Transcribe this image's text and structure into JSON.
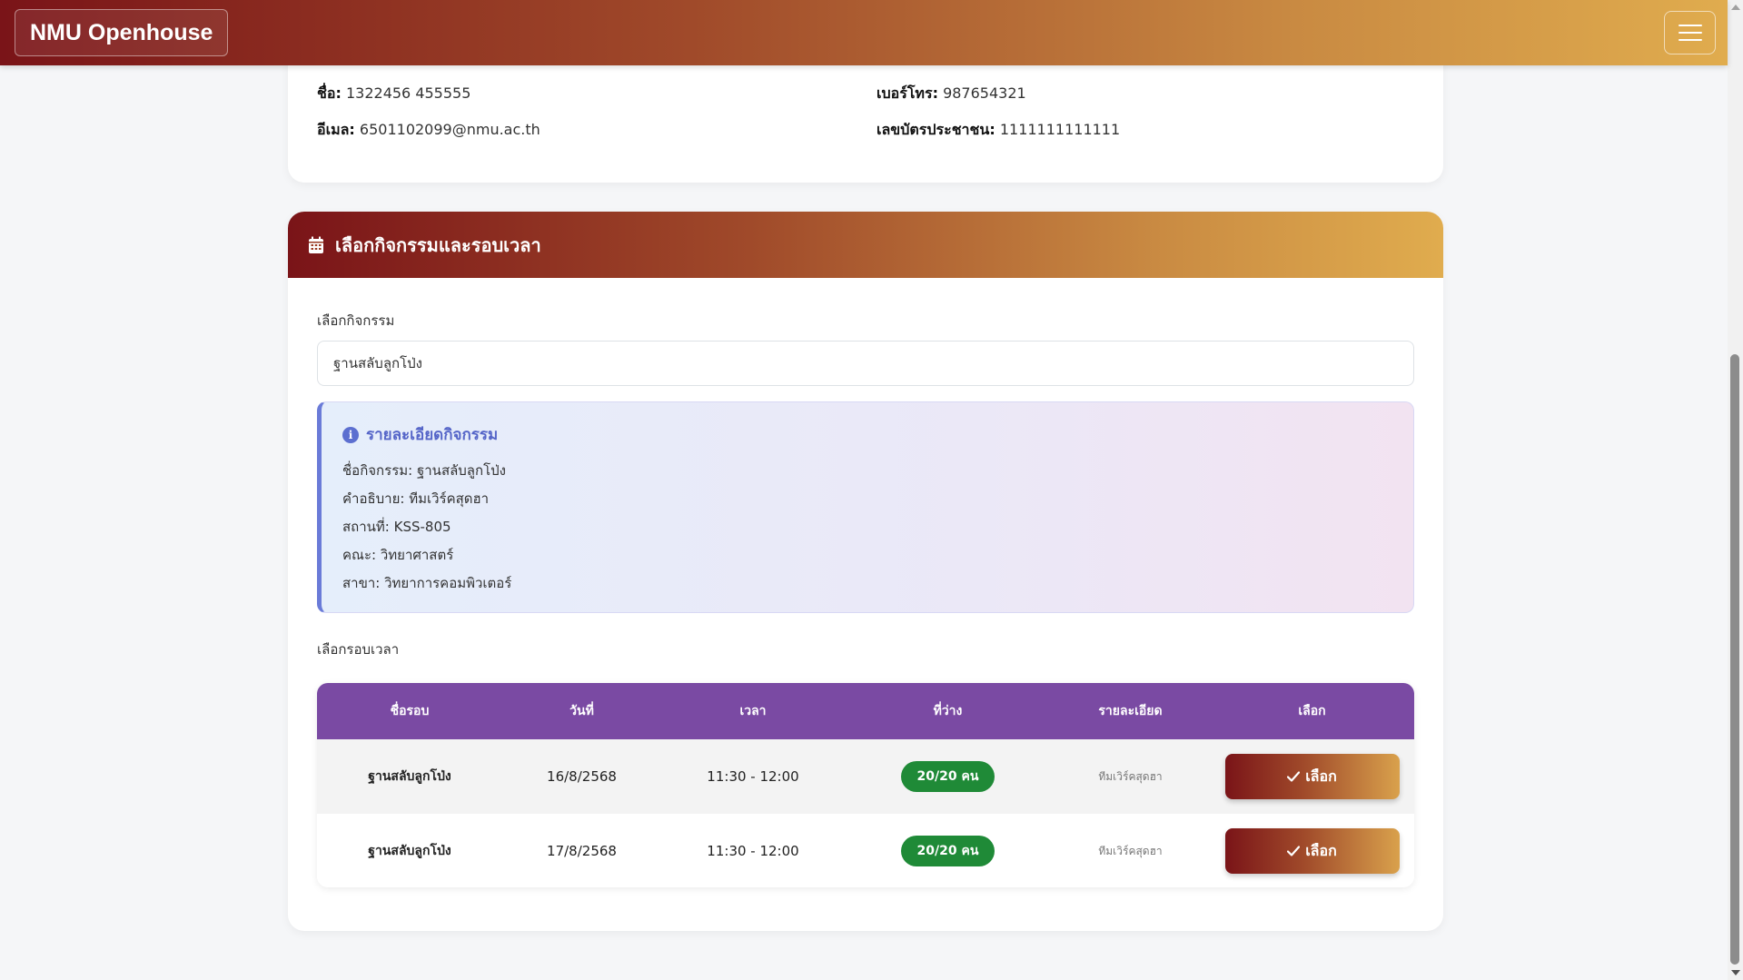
{
  "navbar": {
    "brand": "NMU Openhouse"
  },
  "profile": {
    "name_label": "ชื่อ:",
    "name_value": "1322456 455555",
    "email_label": "อีเมล:",
    "email_value": "6501102099@nmu.ac.th",
    "phone_label": "เบอร์โทร:",
    "phone_value": "987654321",
    "id_label": "เลขบัตรประชาชน:",
    "id_value": "1111111111111"
  },
  "section": {
    "title": "เลือกกิจกรรมและรอบเวลา",
    "activity_label": "เลือกกิจกรรม",
    "activity_selected": "ฐานสลับลูกโป่ง",
    "detail": {
      "title": "รายละเอียดกิจกรรม",
      "name_label": "ชื่อกิจกรรม:",
      "name_value": "ฐานสลับลูกโป่ง",
      "desc_label": "คำอธิบาย:",
      "desc_value": "ทีมเวิร์คสุดฮา",
      "place_label": "สถานที่:",
      "place_value": "KSS-805",
      "faculty_label": "คณะ:",
      "faculty_value": "วิทยาศาสตร์",
      "major_label": "สาขา:",
      "major_value": "วิทยาการคอมพิวเตอร์"
    },
    "round_label": "เลือกรอบเวลา"
  },
  "table": {
    "headers": [
      "ชื่อรอบ",
      "วันที่",
      "เวลา",
      "ที่ว่าง",
      "รายละเอียด",
      "เลือก"
    ],
    "rows": [
      {
        "name": "ฐานสลับลูกโป่ง",
        "date": "16/8/2568",
        "time": "11:30 - 12:00",
        "seats": "20/20 คน",
        "detail": "ทีมเวิร์คสุดฮา",
        "button": "เลือก"
      },
      {
        "name": "ฐานสลับลูกโป่ง",
        "date": "17/8/2568",
        "time": "11:30 - 12:00",
        "seats": "20/20 คน",
        "detail": "ทีมเวิร์คสุดฮา",
        "button": "เลือก"
      }
    ]
  },
  "colors": {
    "brand_dark": "#7a1418",
    "brand_gold": "#e0ac4e",
    "table_header": "#7a4aa3",
    "badge_green": "#1f8a37",
    "detail_accent": "#5c6fd0"
  },
  "icons": [
    "menu-icon",
    "calendar-icon",
    "info-icon",
    "check-icon"
  ]
}
